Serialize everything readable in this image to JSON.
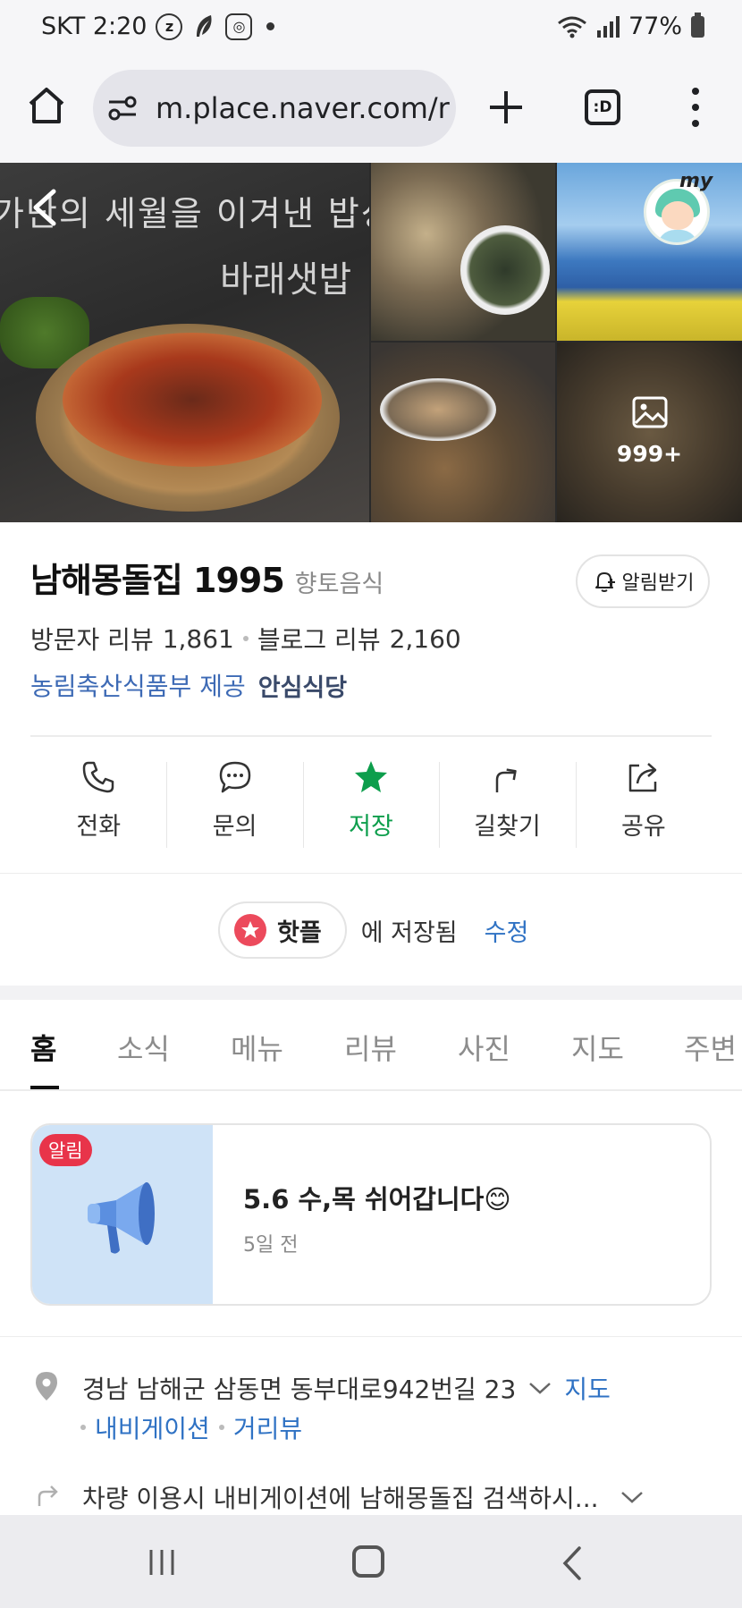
{
  "status_bar": {
    "carrier_time": "SKT 2:20",
    "icons": [
      "z-icon",
      "feather-icon",
      "instagram-icon",
      "dot-icon"
    ],
    "battery": "77%"
  },
  "browser": {
    "url": "m.place.naver.com/r",
    "tabs_label": ":D"
  },
  "gallery": {
    "caption_top": "가난의 세월을 이겨낸 밥상",
    "caption_second": "바래샛밥",
    "avatar_label": "my",
    "more_count": "999+"
  },
  "place": {
    "name": "남해몽돌집 1995",
    "category": "향토음식",
    "alert_button": "알림받기",
    "visitor_review_label": "방문자 리뷰",
    "visitor_review_count": "1,861",
    "blog_review_label": "블로그 리뷰",
    "blog_review_count": "2,160",
    "cert_provider": "농림축산식품부 제공",
    "cert_name": "안심식당"
  },
  "actions": [
    {
      "label": "전화",
      "icon": "phone-icon"
    },
    {
      "label": "문의",
      "icon": "chat-icon"
    },
    {
      "label": "저장",
      "icon": "star-icon",
      "active": true
    },
    {
      "label": "길찾기",
      "icon": "directions-icon"
    },
    {
      "label": "공유",
      "icon": "share-icon"
    }
  ],
  "saved": {
    "list_name": "핫플",
    "saved_text": "에 저장됨",
    "edit_label": "수정"
  },
  "tabs": [
    "홈",
    "소식",
    "메뉴",
    "리뷰",
    "사진",
    "지도",
    "주변"
  ],
  "active_tab": "홈",
  "notice": {
    "badge": "알림",
    "title": "5.6 수,목 쉬어갑니다😊",
    "time": "5일 전"
  },
  "address": {
    "text": "경남 남해군 삼동면 동부대로942번길 23",
    "map_link": "지도",
    "navigation_link": "내비게이션",
    "street_view_link": "거리뷰"
  },
  "route": {
    "text": "차량 이용시 내비게이션에 남해몽돌집 검색하시..."
  },
  "colors": {
    "accent_green": "#0d9e4c",
    "link_blue": "#2f72c4",
    "badge_red": "#e8344a"
  }
}
